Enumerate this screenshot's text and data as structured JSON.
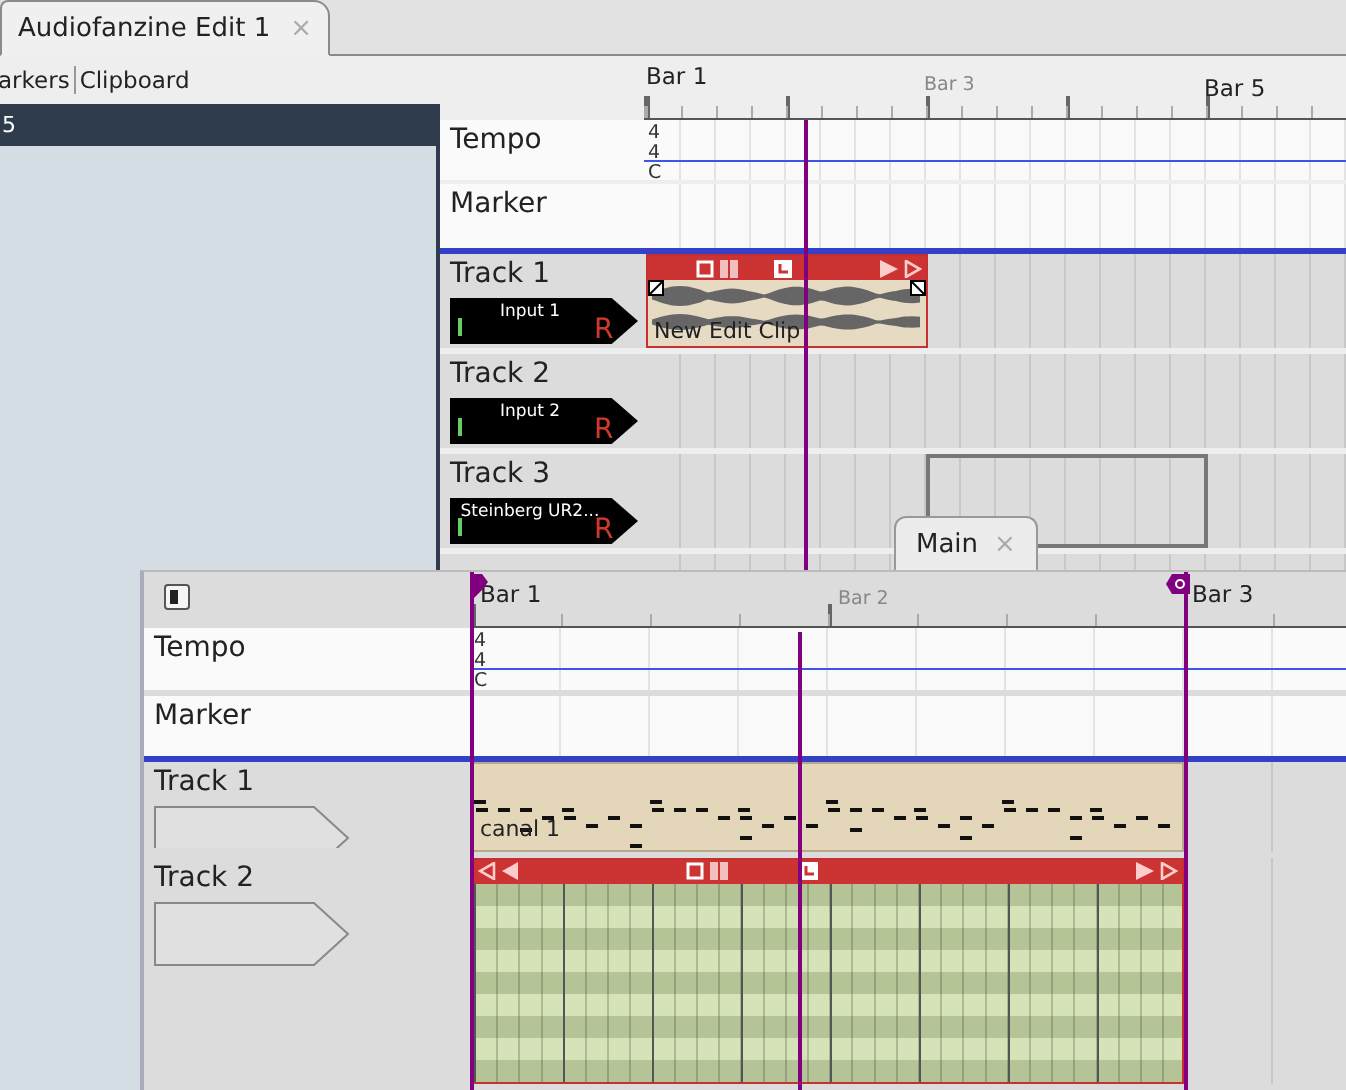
{
  "tabs": [
    {
      "label": "Audiofanzine Edit 1",
      "close": "×",
      "selected": true
    }
  ],
  "toolbar": {
    "items": [
      "arkers",
      "Clipboard"
    ]
  },
  "side_panel": {
    "header": "5"
  },
  "editor": {
    "ruler": [
      {
        "label": "Bar 1",
        "major": true
      },
      {
        "label": "Bar 3",
        "major": false
      },
      {
        "label": "Bar 5",
        "major": true
      }
    ],
    "tempo": {
      "label": "Tempo",
      "signature": [
        "4",
        "4"
      ],
      "key": "C"
    },
    "marker": {
      "label": "Marker"
    },
    "tracks": [
      {
        "name": "Track 1",
        "input": "Input 1",
        "record": "R",
        "clip": {
          "kind": "audio",
          "name": "New Edit Clip"
        }
      },
      {
        "name": "Track 2",
        "input": "Input 2",
        "record": "R"
      },
      {
        "name": "Track 3",
        "input": "Steinberg UR2...",
        "record": "R",
        "clip": {
          "kind": "empty"
        }
      }
    ]
  },
  "main_window": {
    "tab": {
      "label": "Main",
      "close": "×"
    },
    "ruler": [
      {
        "label": "Bar 1",
        "major": true
      },
      {
        "label": "Bar 2",
        "major": false
      },
      {
        "label": "Bar 3",
        "major": true
      }
    ],
    "tempo": {
      "label": "Tempo",
      "signature": [
        "4",
        "4"
      ],
      "key": "C"
    },
    "marker": {
      "label": "Marker"
    },
    "tracks": [
      {
        "name": "Track 1",
        "clip": {
          "kind": "midi",
          "name": "canal 1"
        }
      },
      {
        "name": "Track 2",
        "clip": {
          "kind": "pattern"
        }
      }
    ]
  }
}
